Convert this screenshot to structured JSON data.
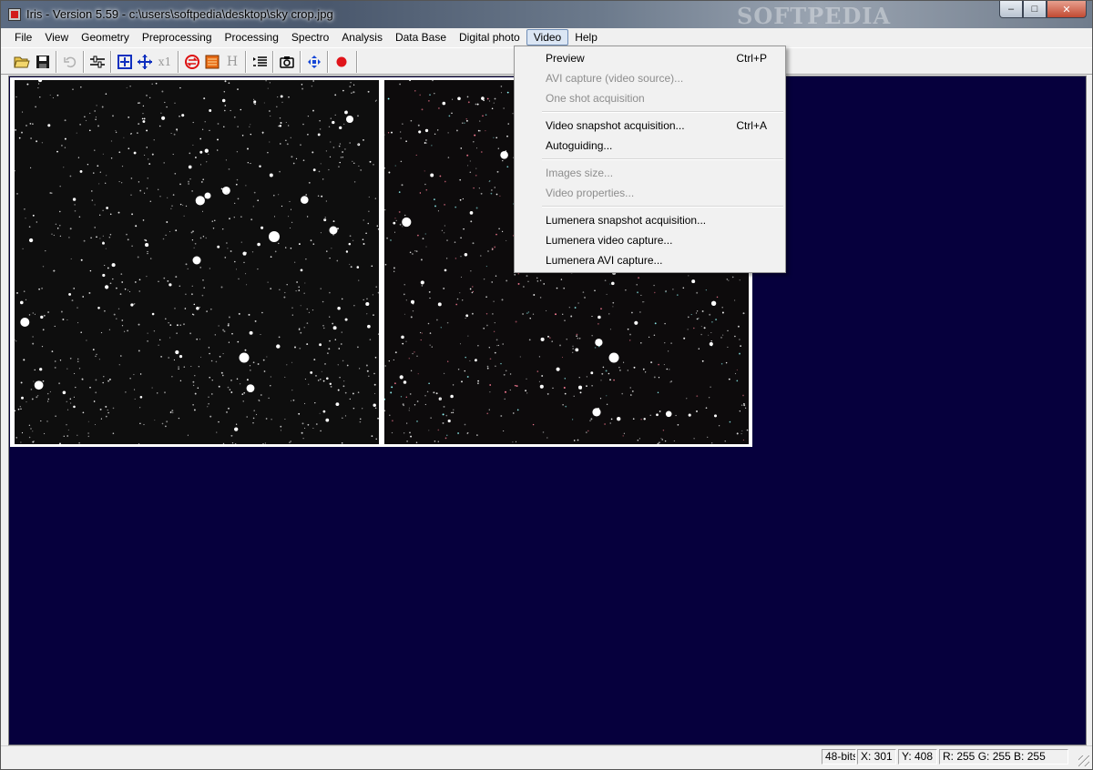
{
  "window": {
    "title": "Iris - Version 5.59 - c:\\users\\softpedia\\desktop\\sky crop.jpg",
    "watermark": "SOFTPEDIA",
    "minimize_glyph": "‒",
    "maximize_glyph": "□",
    "close_glyph": "✕"
  },
  "menubar": {
    "items": [
      "File",
      "View",
      "Geometry",
      "Preprocessing",
      "Processing",
      "Spectro",
      "Analysis",
      "Data Base",
      "Digital photo",
      "Video",
      "Help"
    ],
    "active": "Video"
  },
  "toolbar": {
    "buttons": [
      "open-folder-icon",
      "save-icon",
      "undo-icon",
      "threshold-sliders-icon",
      "zoom-in-icon",
      "zoom-out-icon",
      "zoom-1x-icon",
      "swap-icon",
      "palette-icon",
      "histogram-icon",
      "list-icon",
      "camera-icon",
      "move-icon",
      "record-icon"
    ],
    "x1_label": "x1",
    "h_label": "H"
  },
  "video_menu": {
    "items": [
      {
        "label": "Preview",
        "shortcut": "Ctrl+P",
        "enabled": true
      },
      {
        "label": "AVI capture (video source)...",
        "shortcut": "",
        "enabled": false
      },
      {
        "label": "One shot acquisition",
        "shortcut": "",
        "enabled": false
      },
      {
        "label": "Video snapshot acquisition...",
        "shortcut": "Ctrl+A",
        "enabled": true
      },
      {
        "label": "Autoguiding...",
        "shortcut": "",
        "enabled": true
      },
      {
        "label": "Images size...",
        "shortcut": "",
        "enabled": false
      },
      {
        "label": "Video properties...",
        "shortcut": "",
        "enabled": false
      },
      {
        "label": "Lumenera snapshot acquisition...",
        "shortcut": "",
        "enabled": true
      },
      {
        "label": "Lumenera video capture...",
        "shortcut": "",
        "enabled": true
      },
      {
        "label": "Lumenera AVI capture...",
        "shortcut": "",
        "enabled": true
      }
    ]
  },
  "statusbar": {
    "bit_depth": "48-bits",
    "x": "X: 301",
    "y": "Y: 408",
    "rgb": "R: 255  G: 255  B: 255"
  },
  "colors": {
    "client_background": "#06003d",
    "menu_highlight": "#dbe6f4",
    "disabled_text": "#8d8d8d"
  }
}
